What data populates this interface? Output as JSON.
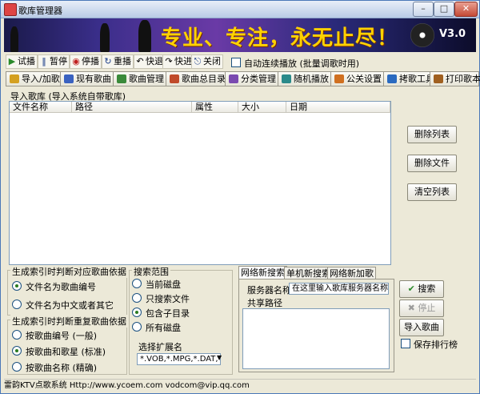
{
  "window": {
    "title": "歌库管理器",
    "min": "0",
    "max": "1",
    "close": "r"
  },
  "banner": {
    "slogan": "专业、专注，永无止尽！",
    "version": "V3.0"
  },
  "toolbar": [
    {
      "icon": "▶",
      "label": "试播",
      "color": "#2a8a2a"
    },
    {
      "icon": "▮▮",
      "label": "暂停",
      "color": "#1b3d8a"
    },
    {
      "icon": "◉",
      "label": "停播",
      "color": "#c02020"
    },
    {
      "icon": "↻",
      "label": "重播",
      "color": "#1b3d8a"
    },
    {
      "icon": "↶",
      "label": "快退",
      "color": "#333333"
    },
    {
      "icon": "↷",
      "label": "快进",
      "color": "#333333"
    },
    {
      "icon": "⎋",
      "label": "关闭",
      "color": "#1b3d8a"
    }
  ],
  "auto_play": {
    "label": "自动连续播放 (批量调歌时用)"
  },
  "tabs": [
    {
      "label": "导入/加歌",
      "color": "#d4a020"
    },
    {
      "label": "现有歌曲",
      "color": "#3a62c0"
    },
    {
      "label": "歌曲管理",
      "color": "#3a8a3a"
    },
    {
      "label": "歌曲总目录",
      "color": "#c04a2a"
    },
    {
      "label": "分类管理",
      "color": "#7a4ab0"
    },
    {
      "label": "随机播放",
      "color": "#2a8a8a"
    },
    {
      "label": "公关设置",
      "color": "#d07020"
    },
    {
      "label": "拷歌工具",
      "color": "#2a6ac0"
    },
    {
      "label": "打印歌本",
      "color": "#a06020"
    }
  ],
  "subtitle": "导入歌库 (导入系统自带歌库)",
  "list_columns": [
    "文件名称",
    "路径",
    "属性",
    "大小",
    "日期"
  ],
  "right_buttons": {
    "delete_list": "删除列表",
    "delete_file": "删除文件",
    "clear_list": "清空列表"
  },
  "index_song": {
    "legend": "生成索引时判断对应歌曲依据",
    "options": [
      "文件名为歌曲编号",
      "文件名为中文或者其它"
    ],
    "selected": 0
  },
  "index_dup": {
    "legend": "生成索引时判断重复歌曲依据",
    "options": [
      "按歌曲编号 (一般)",
      "按歌曲和歌星 (标准)",
      "按歌曲名称 (精确)"
    ],
    "selected": 1
  },
  "search_scope": {
    "legend": "搜索范围",
    "options": [
      "当前磁盘",
      "只搜索文件",
      "包含子目录",
      "所有磁盘"
    ],
    "selected": 2
  },
  "extension": {
    "label": "选择扩展名",
    "value": "*.VOB,*.MPG,*.DAT,*.AVI"
  },
  "net_tabs": [
    "网络新搜索",
    "单机新搜索",
    "网络新加歌"
  ],
  "server": {
    "label": "服务器名称",
    "placeholder": "在这里输入歌库服务器名称"
  },
  "share_path": {
    "label": "共享路径"
  },
  "actions": {
    "search": "搜索",
    "stop": "停止",
    "import": "导入歌曲",
    "save_rank": "保存排行榜"
  },
  "status": "雷韵KTV点歌系统 Http://www.ycoem.com vodcom@vip.qq.com"
}
